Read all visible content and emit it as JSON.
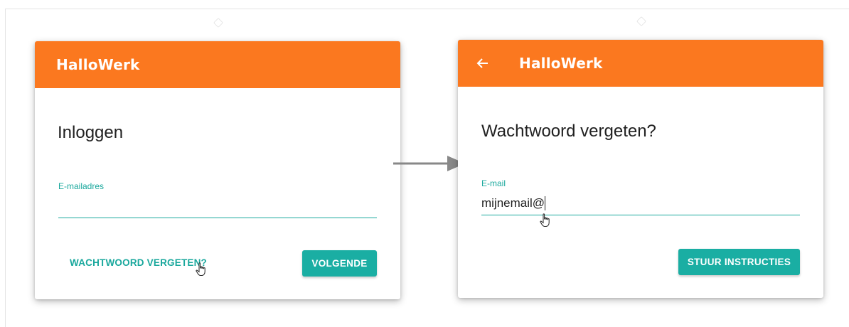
{
  "left_card": {
    "brand": "HalloWerk",
    "title": "Inloggen",
    "email_label": "E-mailadres",
    "email_value": "",
    "forgot_button": "WACHTWOORD VERGETEN?",
    "next_button": "VOLGENDE"
  },
  "right_card": {
    "brand": "HalloWerk",
    "title": "Wachtwoord vergeten?",
    "email_label": "E-mail",
    "email_value": "mijnemail@",
    "submit_button": "STUUR INSTRUCTIES"
  },
  "icons": {
    "back": "arrow-left-icon",
    "transition": "arrow-right-icon",
    "pointer": "hand-pointer-icon"
  },
  "colors": {
    "appbar": "#fb781f",
    "accent": "#1aa89d",
    "button": "#1aaea3"
  }
}
